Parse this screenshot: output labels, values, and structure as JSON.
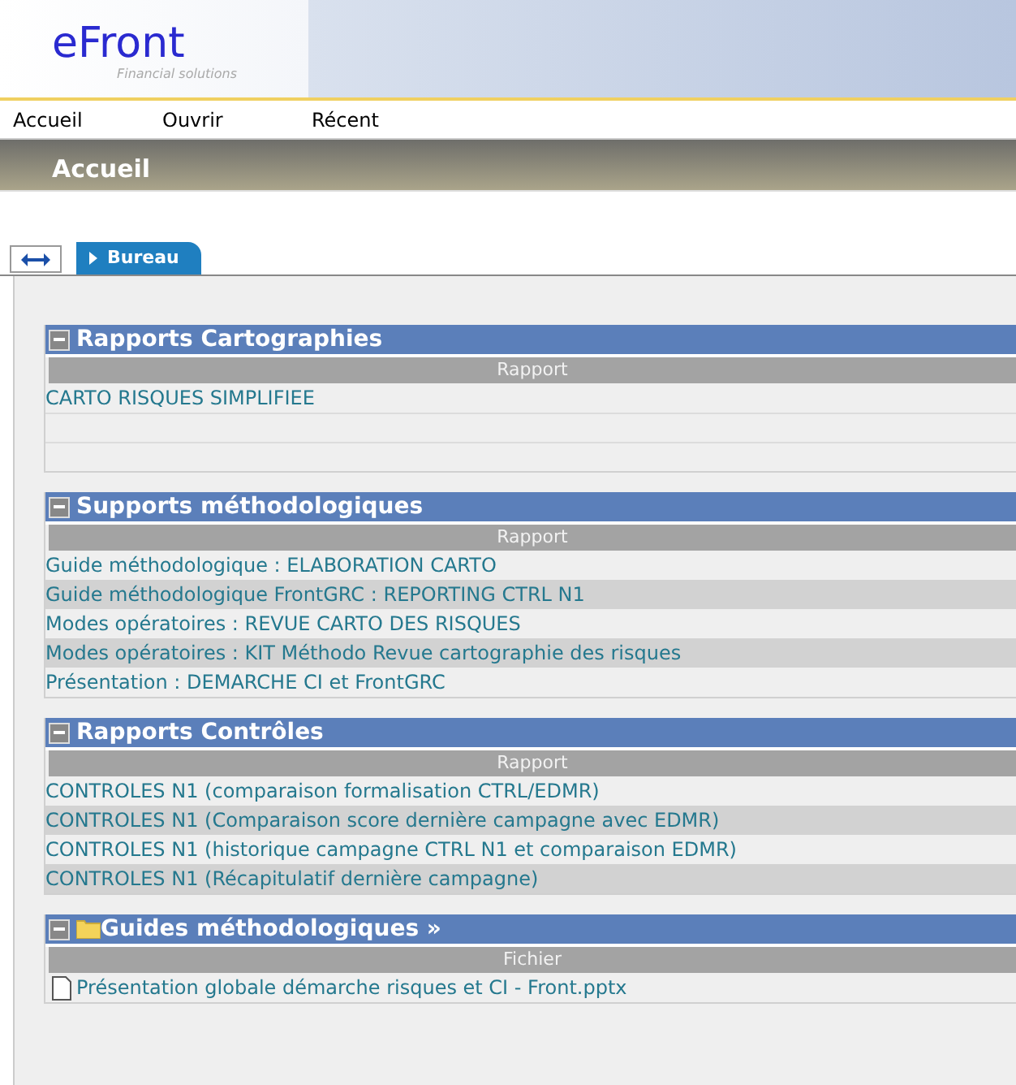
{
  "logo": {
    "name": "eFront",
    "tagline": "Financial solutions"
  },
  "menu": [
    {
      "label": "Accueil"
    },
    {
      "label": "Ouvrir"
    },
    {
      "label": "Récent"
    }
  ],
  "page_title": "Accueil",
  "tabs": [
    {
      "label": "Bureau",
      "selected": true
    }
  ],
  "sections": [
    {
      "kind": "report",
      "title": "Rapports Cartographies",
      "column": "Rapport",
      "rows": [
        "CARTO RISQUES SIMPLIFIEE"
      ]
    },
    {
      "kind": "report",
      "title": "Supports méthodologiques",
      "column": "Rapport",
      "rows": [
        "Guide méthodologique : ELABORATION CARTO",
        "Guide méthodologique FrontGRC : REPORTING CTRL N1",
        "Modes opératoires : REVUE CARTO DES RISQUES",
        "Modes opératoires : KIT Méthodo Revue cartographie des risques",
        "Présentation : DEMARCHE CI et FrontGRC"
      ]
    },
    {
      "kind": "report",
      "title": "Rapports Contrôles",
      "column": "Rapport",
      "rows": [
        "CONTROLES N1 (comparaison formalisation CTRL/EDMR)",
        "CONTROLES N1 (Comparaison score dernière campagne avec EDMR)",
        "CONTROLES N1 (historique campagne CTRL N1 et comparaison EDMR)",
        "CONTROLES N1 (Récapitulatif dernière campagne)"
      ]
    },
    {
      "kind": "folder",
      "title": "Guides méthodologiques »",
      "column": "Fichier",
      "rows": [
        "Présentation globale démarche risques et CI - Front.pptx"
      ]
    }
  ]
}
